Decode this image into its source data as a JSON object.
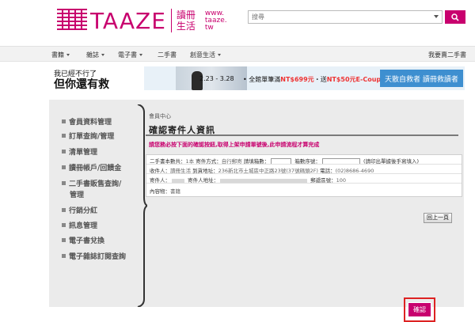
{
  "brand": {
    "name": "TAAZE",
    "cn_line1": "讀冊",
    "cn_line2": "生活",
    "url_line1": "www.",
    "url_line2": "taaze.",
    "url_line3": "tw",
    "color": "#c8006e"
  },
  "search": {
    "placeholder": "搜尋",
    "button_icon": "search-icon"
  },
  "nav": {
    "items": [
      {
        "label": "書籍",
        "has_dropdown": true
      },
      {
        "label": "雜誌",
        "has_dropdown": true
      },
      {
        "label": "電子書",
        "has_dropdown": true
      },
      {
        "label": "二手書",
        "has_dropdown": false
      },
      {
        "label": "創意生活",
        "has_dropdown": true
      }
    ],
    "right_link": "我要賣二手書"
  },
  "banner": {
    "small": "我已經不行了",
    "big": "但你還有救",
    "date": "2.23 - 3.28",
    "promo_prefix": "全館單筆滿",
    "promo_amount": "NT$699元",
    "promo_mid": "送",
    "promo_coupon": "NT$50元E-Coupon",
    "right_text": "天散自救者 讀冊救讀者"
  },
  "sidebar": {
    "items": [
      "會員資料管理",
      "訂單查詢/管理",
      "清單管理",
      "讀冊帳戶/回饋金",
      "二手書販售查詢/",
      "管理",
      "行銷分紅",
      "訊息管理",
      "電子書兌換",
      "電子雜誌訂閱查詢"
    ]
  },
  "content": {
    "breadcrumb": "會員中心",
    "title": "確認寄件人資訊",
    "notice": "請您務必按下面的確認按鈕,取得上架申請單號後,此申請流程才算完成",
    "row1": {
      "count_label": "二手書本數共：",
      "count_val": "1本",
      "ship_label": "寄件方式：",
      "ship_val": "自行郵寄",
      "fill_label": "請填",
      "fill_label2": "箱數：",
      "box_label": "箱數序號：",
      "box_hint": "(請印出單據後手寫填入)"
    },
    "row2": {
      "recipient_label": "收件人：",
      "recipient_val": "讀冊生活",
      "addr_label": "到貨地址：",
      "addr_val": "236新北市土城區中正路23號(37號碼頭2F)",
      "phone_label": "電話：",
      "phone_val": "(02)8686-4690"
    },
    "row3": {
      "sender_label": "寄件人：",
      "sender_addr_label": "寄件人地址：",
      "zip_label": "郵遞區號：",
      "zip_val": "100"
    },
    "row4": {
      "content_label": "內容物：",
      "content_val": "書籍"
    },
    "back_button": "回上一頁",
    "confirm_button": "確認"
  }
}
